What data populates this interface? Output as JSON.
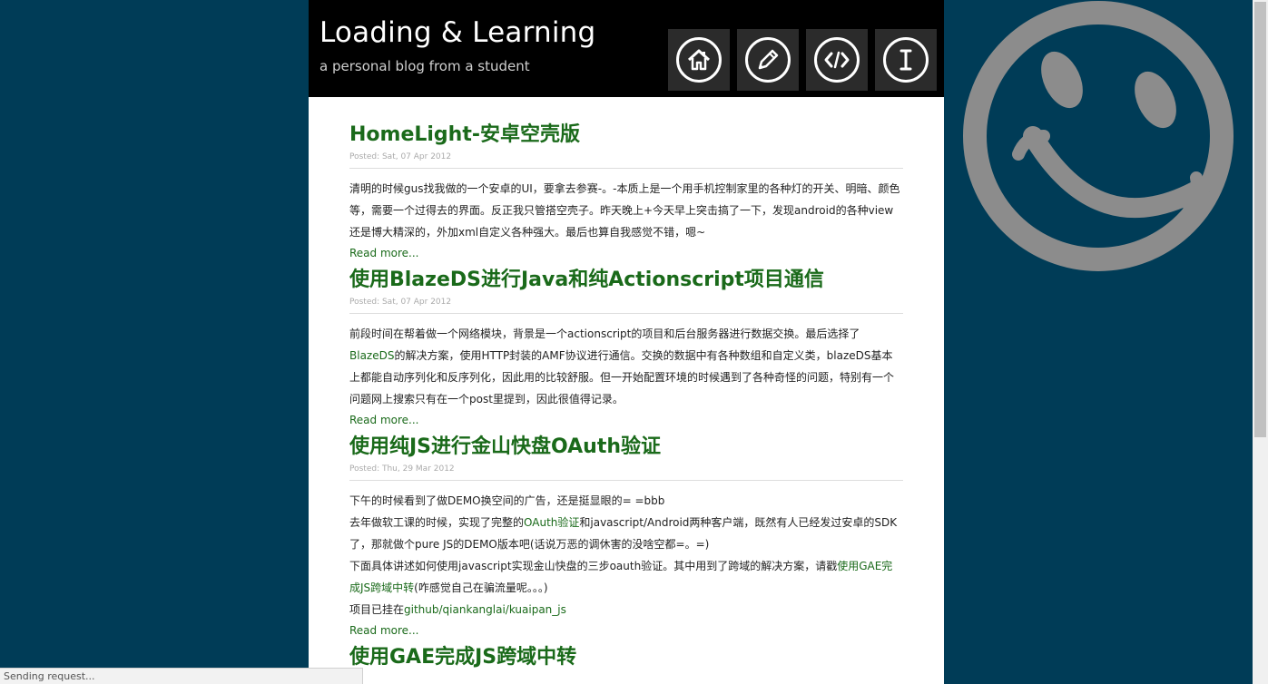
{
  "header": {
    "title": "Loading & Learning",
    "subtitle": "a personal blog from a student"
  },
  "nav": [
    {
      "icon": "home-icon"
    },
    {
      "icon": "pencil-icon"
    },
    {
      "icon": "code-icon"
    },
    {
      "icon": "text-cursor-icon"
    }
  ],
  "posts": [
    {
      "title": "HomeLight-安卓空壳版",
      "meta": "Posted: Sat, 07 Apr 2012",
      "body": [
        "清明的时候gus找我做的一个安卓的UI，要拿去参赛-。-本质上是一个用手机控制家里的各种灯的开关、明暗、颜色等，需要一个过得去的界面。反正我只管搭空壳子。昨天晚上+今天早上突击搞了一下，发现android的各种view还是博大精深的，外加xml自定义各种强大。最后也算自我感觉不错，嗯~"
      ],
      "read_more": "Read more..."
    },
    {
      "title": "使用BlazeDS进行Java和纯Actionscript项目通信",
      "meta": "Posted: Sat, 07 Apr 2012",
      "body_parts": {
        "p1": "前段时间在帮着做一个网络模块，背景是一个actionscript的项目和后台服务器进行数据交换。最后选择了",
        "link": "BlazeDS",
        "p2": "的解决方案，使用HTTP封装的AMF协议进行通信。交换的数据中有各种数组和自定义类，blazeDS基本上都能自动序列化和反序列化，因此用的比较舒服。但一开始配置环境的时候遇到了各种奇怪的问题，特别有一个问题网上搜索只有在一个post里提到，因此很值得记录。"
      },
      "read_more": "Read more..."
    },
    {
      "title": "使用纯JS进行金山快盘OAuth验证",
      "meta": "Posted: Thu, 29 Mar 2012",
      "lines": {
        "l1": "下午的时候看到了做DEMO换空间的广告，还是挺显眼的= =bbb",
        "l2a": "去年做软工课的时候，实现了完整的",
        "l2link": "OAuth验证",
        "l2b": "和javascript/Android两种客户端，既然有人已经发过安卓的SDK了，那就做个pure JS的DEMO版本吧(话说万恶的调休害的没啥空都=。=)",
        "l3a": "下面具体讲述如何使用javascript实现金山快盘的三步oauth验证。其中用到了跨域的解决方案，请戳",
        "l3link": "使用GAE完成JS跨域中转",
        "l3b": "(咋感觉自己在骗流量呢。。。)",
        "l4a": "项目已挂在",
        "l4link": "github/qiankanglai/kuaipan_js"
      },
      "read_more": "Read more..."
    },
    {
      "title": "使用GAE完成JS跨域中转"
    }
  ],
  "status_bar": "Sending request...",
  "colors": {
    "background": "#003c57",
    "header": "#000000",
    "accent": "#1a6a1a",
    "smiley": "#8c8c8c"
  },
  "decoration": {
    "icon": "smiley-icon"
  }
}
